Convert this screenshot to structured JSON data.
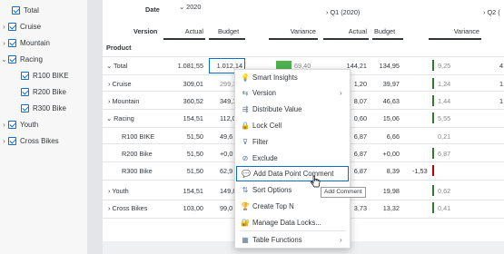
{
  "tree": [
    {
      "label": "Total",
      "chevron": "",
      "level": 0
    },
    {
      "label": "Cruise",
      "chevron": "›",
      "level": 0
    },
    {
      "label": "Mountain",
      "chevron": "›",
      "level": 0
    },
    {
      "label": "Racing",
      "chevron": "⌄",
      "level": 0
    },
    {
      "label": "R100 BIKE",
      "chevron": "",
      "level": 1
    },
    {
      "label": "R200 Bike",
      "chevron": "",
      "level": 1
    },
    {
      "label": "R300 Bike",
      "chevron": "",
      "level": 1
    },
    {
      "label": "Youth",
      "chevron": "›",
      "level": 0
    },
    {
      "label": "Cross Bikes",
      "chevron": "›",
      "level": 0
    }
  ],
  "header": {
    "date_label": "Date",
    "year": "2020",
    "q1": "Q1 (2020)",
    "q2": "Q2 (",
    "version_label": "Version",
    "product_label": "Product",
    "cols": [
      "Actual",
      "Budget",
      "Variance",
      "Actual",
      "Budget",
      "Variance"
    ]
  },
  "rows": [
    {
      "label": "Total",
      "chevron": "⌄",
      "actual": "1.081,55",
      "budget": "1.012,14",
      "variance": "69,40",
      "q1_actual": "144,21",
      "q1_budget": "134,95",
      "q1_variance": "9,25",
      "q2": "4"
    },
    {
      "label": "Cruise",
      "chevron": "›",
      "actual": "309,01",
      "budget": "299,3",
      "variance": "",
      "q1_actual": "1,20",
      "q1_budget": "39,97",
      "q1_variance": "1,24",
      "q2": "1"
    },
    {
      "label": "Mountain",
      "chevron": "›",
      "actual": "360,52",
      "budget": "349,1",
      "variance": "",
      "q1_actual": "8,07",
      "q1_budget": "46,63",
      "q1_variance": "1,44",
      "q2": "1"
    },
    {
      "label": "Racing",
      "chevron": "⌄",
      "actual": "154,51",
      "budget": "112,0",
      "variance": "",
      "q1_actual": "0,60",
      "q1_budget": "15,06",
      "q1_variance": "5,55",
      "q2": ""
    },
    {
      "label": "R100 BIKE",
      "chevron": "",
      "actual": "51,50",
      "budget": "49,6",
      "variance": "",
      "q1_actual": "6,87",
      "q1_budget": "6,66",
      "q1_variance": "0,21",
      "q2": ""
    },
    {
      "label": "R200 Bike",
      "chevron": "",
      "actual": "51,50",
      "budget": "+0,0",
      "variance": "",
      "q1_actual": "6,87",
      "q1_budget": "+0,00",
      "q1_variance": "6,87",
      "q2": ""
    },
    {
      "label": "R300 Bike",
      "chevron": "",
      "actual": "51,50",
      "budget": "62,9",
      "variance": "",
      "q1_actual": "6,87",
      "q1_budget": "8,39",
      "q1_variance": "-1,53",
      "q2": ""
    },
    {
      "label": "Youth",
      "chevron": "›",
      "actual": "154,51",
      "budget": "149,8",
      "variance": "",
      "q1_actual": "0,60",
      "q1_budget": "19,98",
      "q1_variance": "0,62",
      "q2": ""
    },
    {
      "label": "Cross Bikes",
      "chevron": "›",
      "actual": "103,00",
      "budget": "99,0",
      "variance": "",
      "q1_actual": "3,73",
      "q1_budget": "13,32",
      "q1_variance": "0,41",
      "q2": ""
    }
  ],
  "menu": {
    "items": [
      {
        "label": "Smart Insights",
        "icon": "lightbulb-icon",
        "glyph": "💡",
        "sub": false
      },
      {
        "label": "Version",
        "icon": "versions-icon",
        "glyph": "⇆",
        "sub": true
      },
      {
        "label": "Distribute Value",
        "icon": "distribute-icon",
        "glyph": "⇶",
        "sub": false
      },
      {
        "label": "Lock Cell",
        "icon": "lock-icon",
        "glyph": "🔒",
        "sub": false
      },
      {
        "label": "Filter",
        "icon": "filter-icon",
        "glyph": "⊽",
        "sub": false
      },
      {
        "label": "Exclude",
        "icon": "exclude-icon",
        "glyph": "⊘",
        "sub": false
      },
      {
        "label": "Add Data Point Comment",
        "icon": "comment-icon",
        "glyph": "💬",
        "sub": false
      },
      {
        "label": "Sort Options",
        "icon": "sort-icon",
        "glyph": "⇅",
        "sub": false
      },
      {
        "label": "Create Top N",
        "icon": "top-n-icon",
        "glyph": "🏆",
        "sub": false
      },
      {
        "label": "Manage Data Locks...",
        "icon": "data-lock-icon",
        "glyph": "🔐",
        "sub": false
      },
      {
        "label": "Table Functions",
        "icon": "table-icon",
        "glyph": "▦",
        "sub": true
      }
    ],
    "tooltip": "Add Comment"
  },
  "colors": {
    "accent": "#0a6ed1",
    "positive": "#2b7d2b",
    "negative": "#bb0000",
    "bar_green": "#4fb24f"
  }
}
